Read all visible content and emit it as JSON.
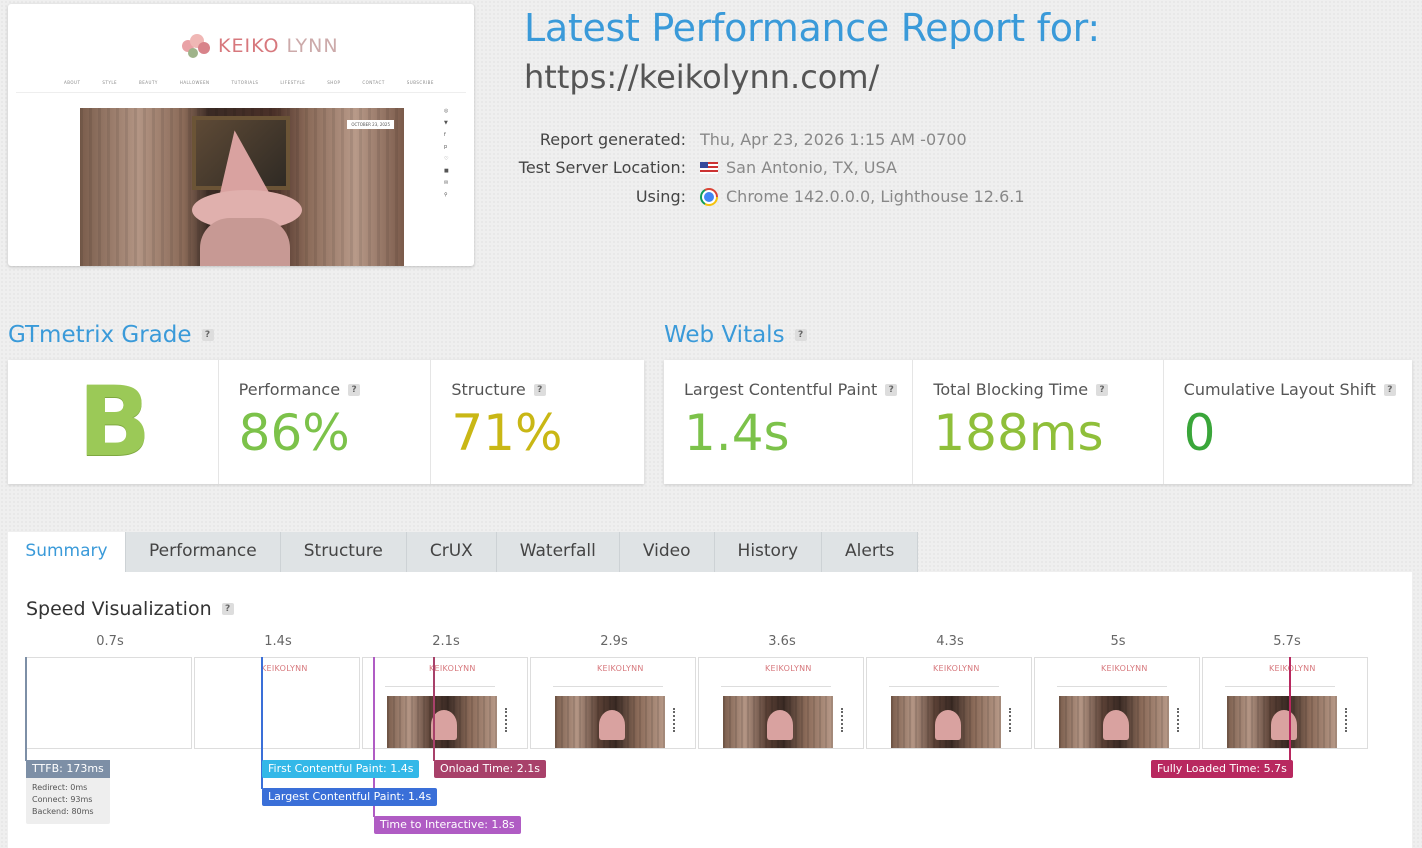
{
  "preview": {
    "logo_text_a": "KEIKO",
    "logo_text_b": "LYNN",
    "menu": [
      "ABOUT",
      "STYLE",
      "BEAUTY",
      "HALLOWEEN",
      "TUTORIALS",
      "LIFESTYLE",
      "SHOP",
      "CONTACT",
      "SUBSCRIBE"
    ],
    "date": "OCTOBER 23, 2025"
  },
  "header": {
    "title": "Latest Performance Report for:",
    "url": "https://keikolynn.com/",
    "report_generated_label": "Report generated:",
    "report_generated_value": "Thu, Apr 23, 2026 1:15 AM -0700",
    "server_label": "Test Server Location:",
    "server_value": "San Antonio, TX, USA",
    "using_label": "Using:",
    "using_value": "Chrome 142.0.0.0, Lighthouse 12.6.1"
  },
  "gtmetrix": {
    "title": "GTmetrix Grade",
    "grade": "B",
    "performance_label": "Performance",
    "performance_value": "86%",
    "structure_label": "Structure",
    "structure_value": "71%"
  },
  "vitals": {
    "title": "Web Vitals",
    "lcp_label": "Largest Contentful Paint",
    "lcp_value": "1.4s",
    "tbt_label": "Total Blocking Time",
    "tbt_value": "188ms",
    "cls_label": "Cumulative Layout Shift",
    "cls_value": "0"
  },
  "colors": {
    "accent": "#3a9ad9",
    "good": "#7cc24a",
    "ok": "#c9b715",
    "ttfb": "#7d8fa6",
    "fcp": "#33b8e8",
    "lcp": "#3a6fd8",
    "tti": "#b05cc4",
    "onload": "#a8416a",
    "fully_loaded": "#b8285f"
  },
  "tabs": [
    "Summary",
    "Performance",
    "Structure",
    "CrUX",
    "Waterfall",
    "Video",
    "History",
    "Alerts"
  ],
  "speed": {
    "title": "Speed Visualization",
    "time_labels": [
      "0.7s",
      "1.4s",
      "2.1s",
      "2.9s",
      "3.6s",
      "4.3s",
      "5s",
      "5.7s"
    ],
    "frame_logo": "KEIKOLYNN",
    "ttfb": "TTFB: 173ms",
    "redirect": "Redirect: 0ms",
    "connect": "Connect: 93ms",
    "backend": "Backend: 80ms",
    "fcp": "First Contentful Paint: 1.4s",
    "lcp": "Largest Contentful Paint: 1.4s",
    "tti": "Time to Interactive: 1.8s",
    "onload": "Onload Time: 2.1s",
    "fully_loaded": "Fully Loaded Time: 5.7s"
  }
}
